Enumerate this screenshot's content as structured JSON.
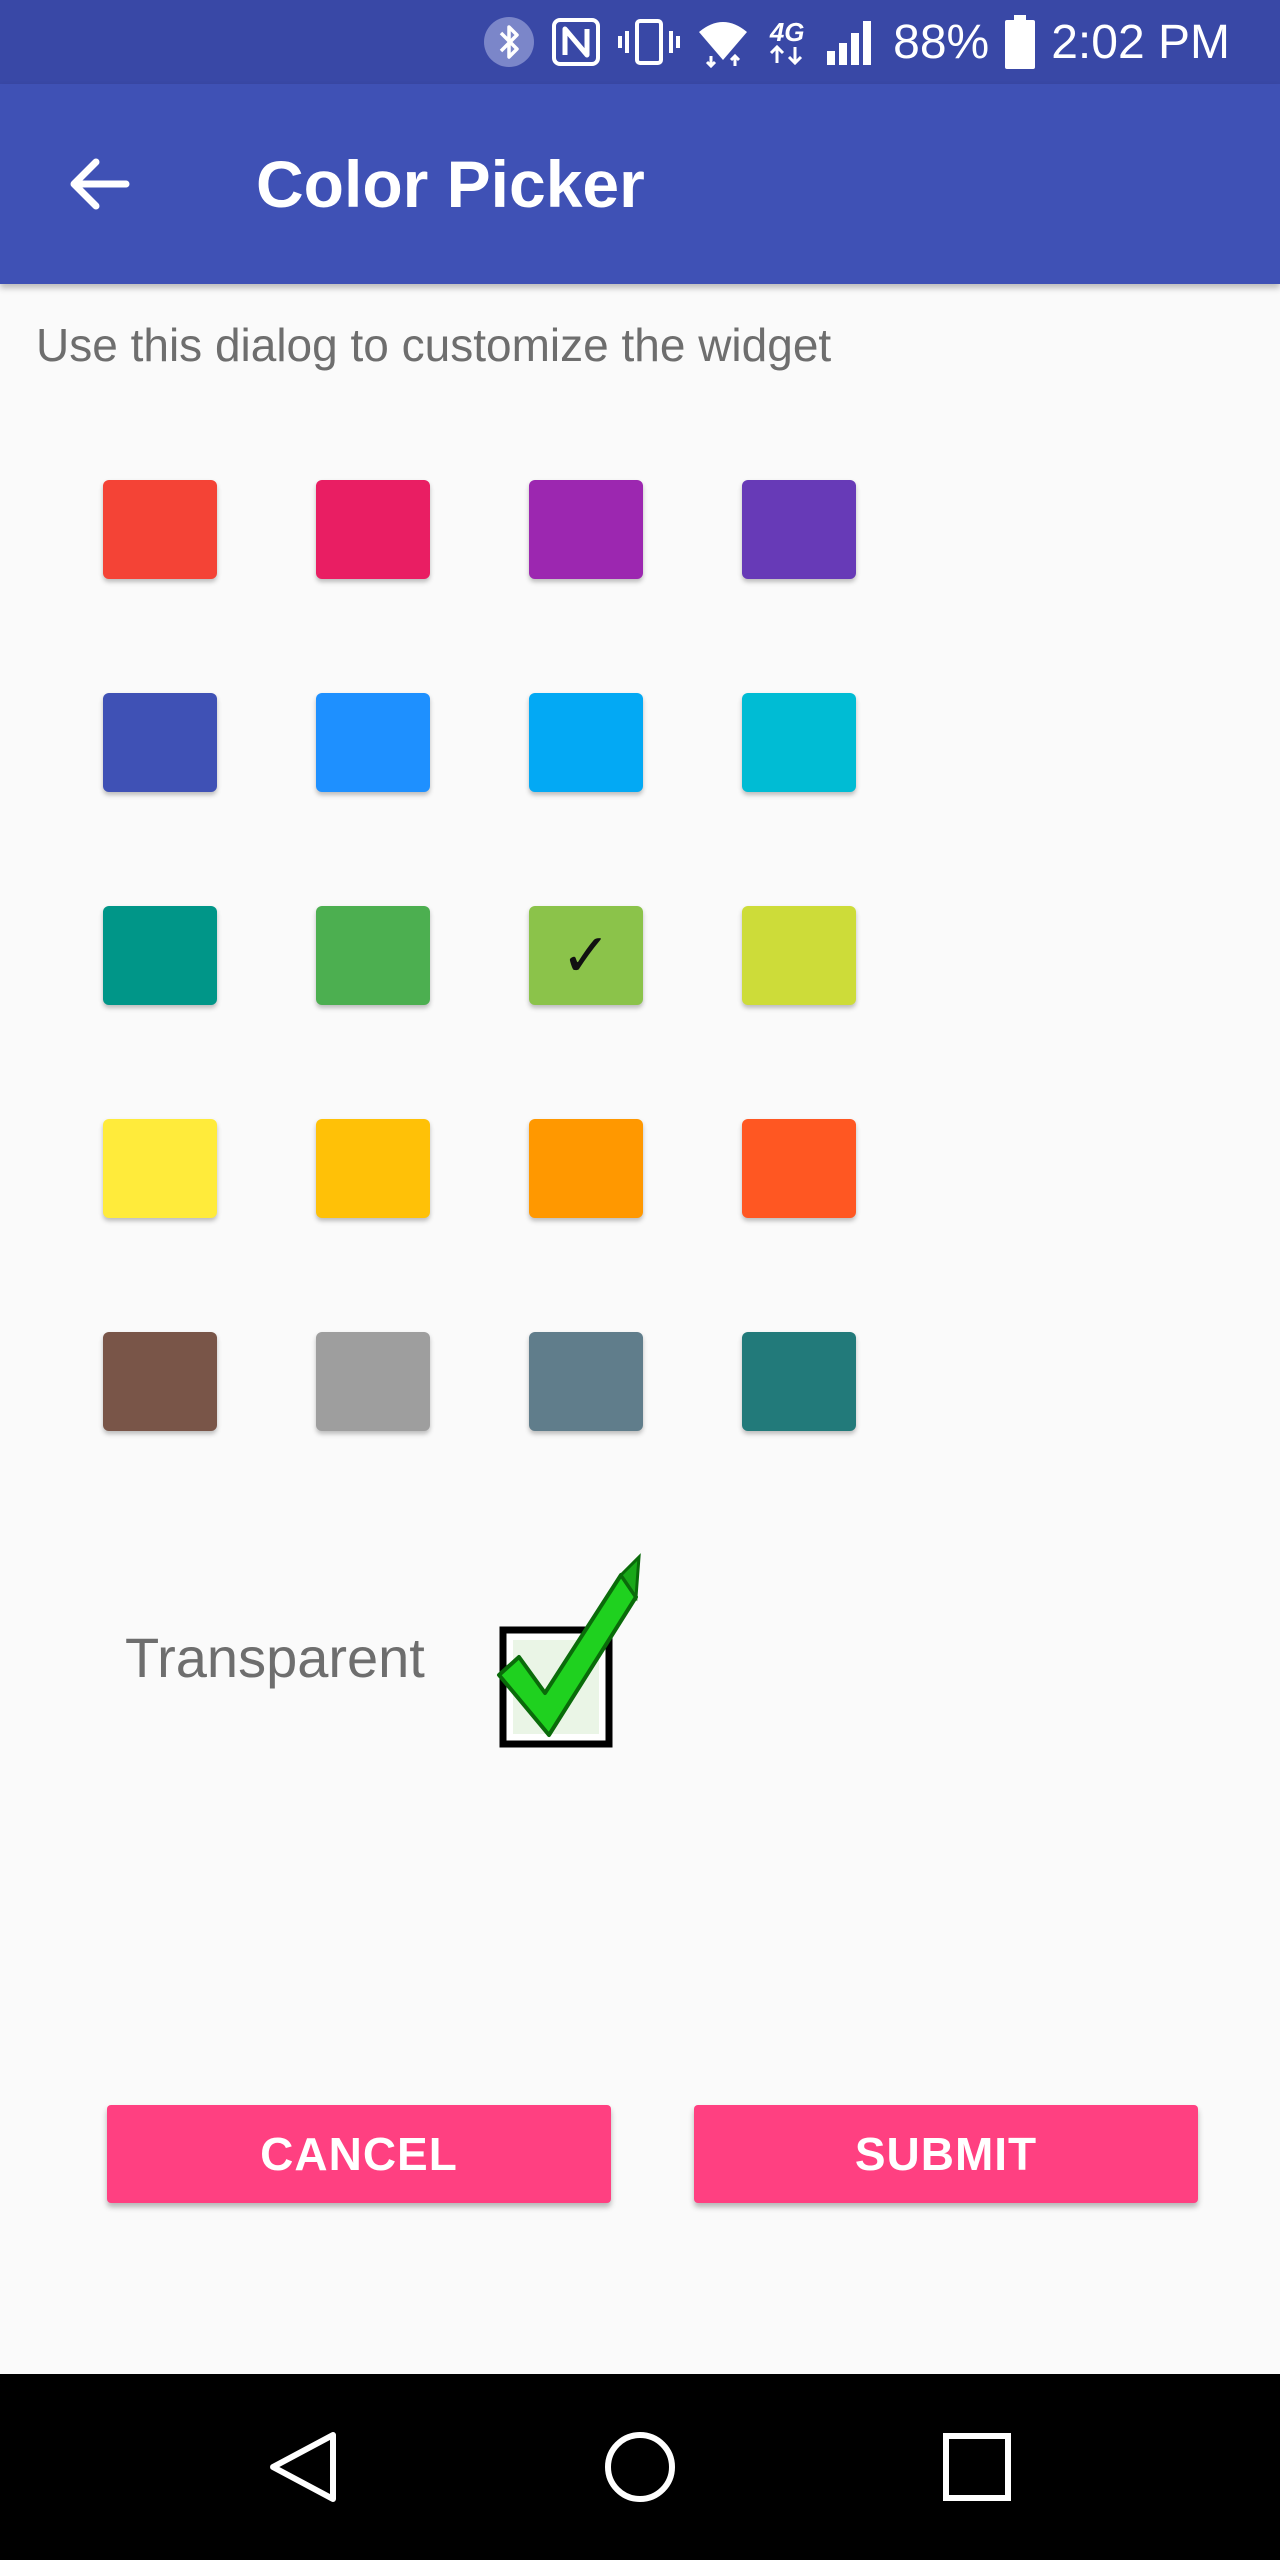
{
  "status_bar": {
    "battery": "88%",
    "time": "2:02 PM",
    "icons": [
      "bluetooth-icon",
      "nfc-icon",
      "vibrate-icon",
      "wifi-icon",
      "4g-lte-icon",
      "signal-icon",
      "battery-icon"
    ],
    "network_label": "4G"
  },
  "app_bar": {
    "title": "Color Picker",
    "back_icon": "arrow-back-icon"
  },
  "subtitle": "Use this dialog to customize the widget",
  "swatches": [
    {
      "color": "#f44336",
      "selected": false
    },
    {
      "color": "#e91e63",
      "selected": false
    },
    {
      "color": "#9c27b0",
      "selected": false
    },
    {
      "color": "#673ab7",
      "selected": false
    },
    {
      "color": "#3f51b5",
      "selected": false
    },
    {
      "color": "#1e90ff",
      "selected": false
    },
    {
      "color": "#03a9f4",
      "selected": false
    },
    {
      "color": "#00bcd4",
      "selected": false
    },
    {
      "color": "#009688",
      "selected": false
    },
    {
      "color": "#4caf50",
      "selected": false
    },
    {
      "color": "#8bc34a",
      "selected": true,
      "check_mark": "✓"
    },
    {
      "color": "#cddc39",
      "selected": false
    },
    {
      "color": "#ffeb3b",
      "selected": false
    },
    {
      "color": "#ffc107",
      "selected": false
    },
    {
      "color": "#ff9800",
      "selected": false
    },
    {
      "color": "#ff5722",
      "selected": false
    },
    {
      "color": "#795548",
      "selected": false
    },
    {
      "color": "#9e9e9e",
      "selected": false
    },
    {
      "color": "#607d8b",
      "selected": false
    },
    {
      "color": "#227a7a",
      "selected": false
    }
  ],
  "transparent": {
    "label": "Transparent",
    "checked": true,
    "check_color": "#22cc22"
  },
  "buttons": {
    "cancel": "CANCEL",
    "submit": "SUBMIT",
    "color": "#ff4081"
  },
  "nav_bar": {
    "icons": [
      "back-triangle-icon",
      "home-circle-icon",
      "recents-square-icon"
    ]
  }
}
